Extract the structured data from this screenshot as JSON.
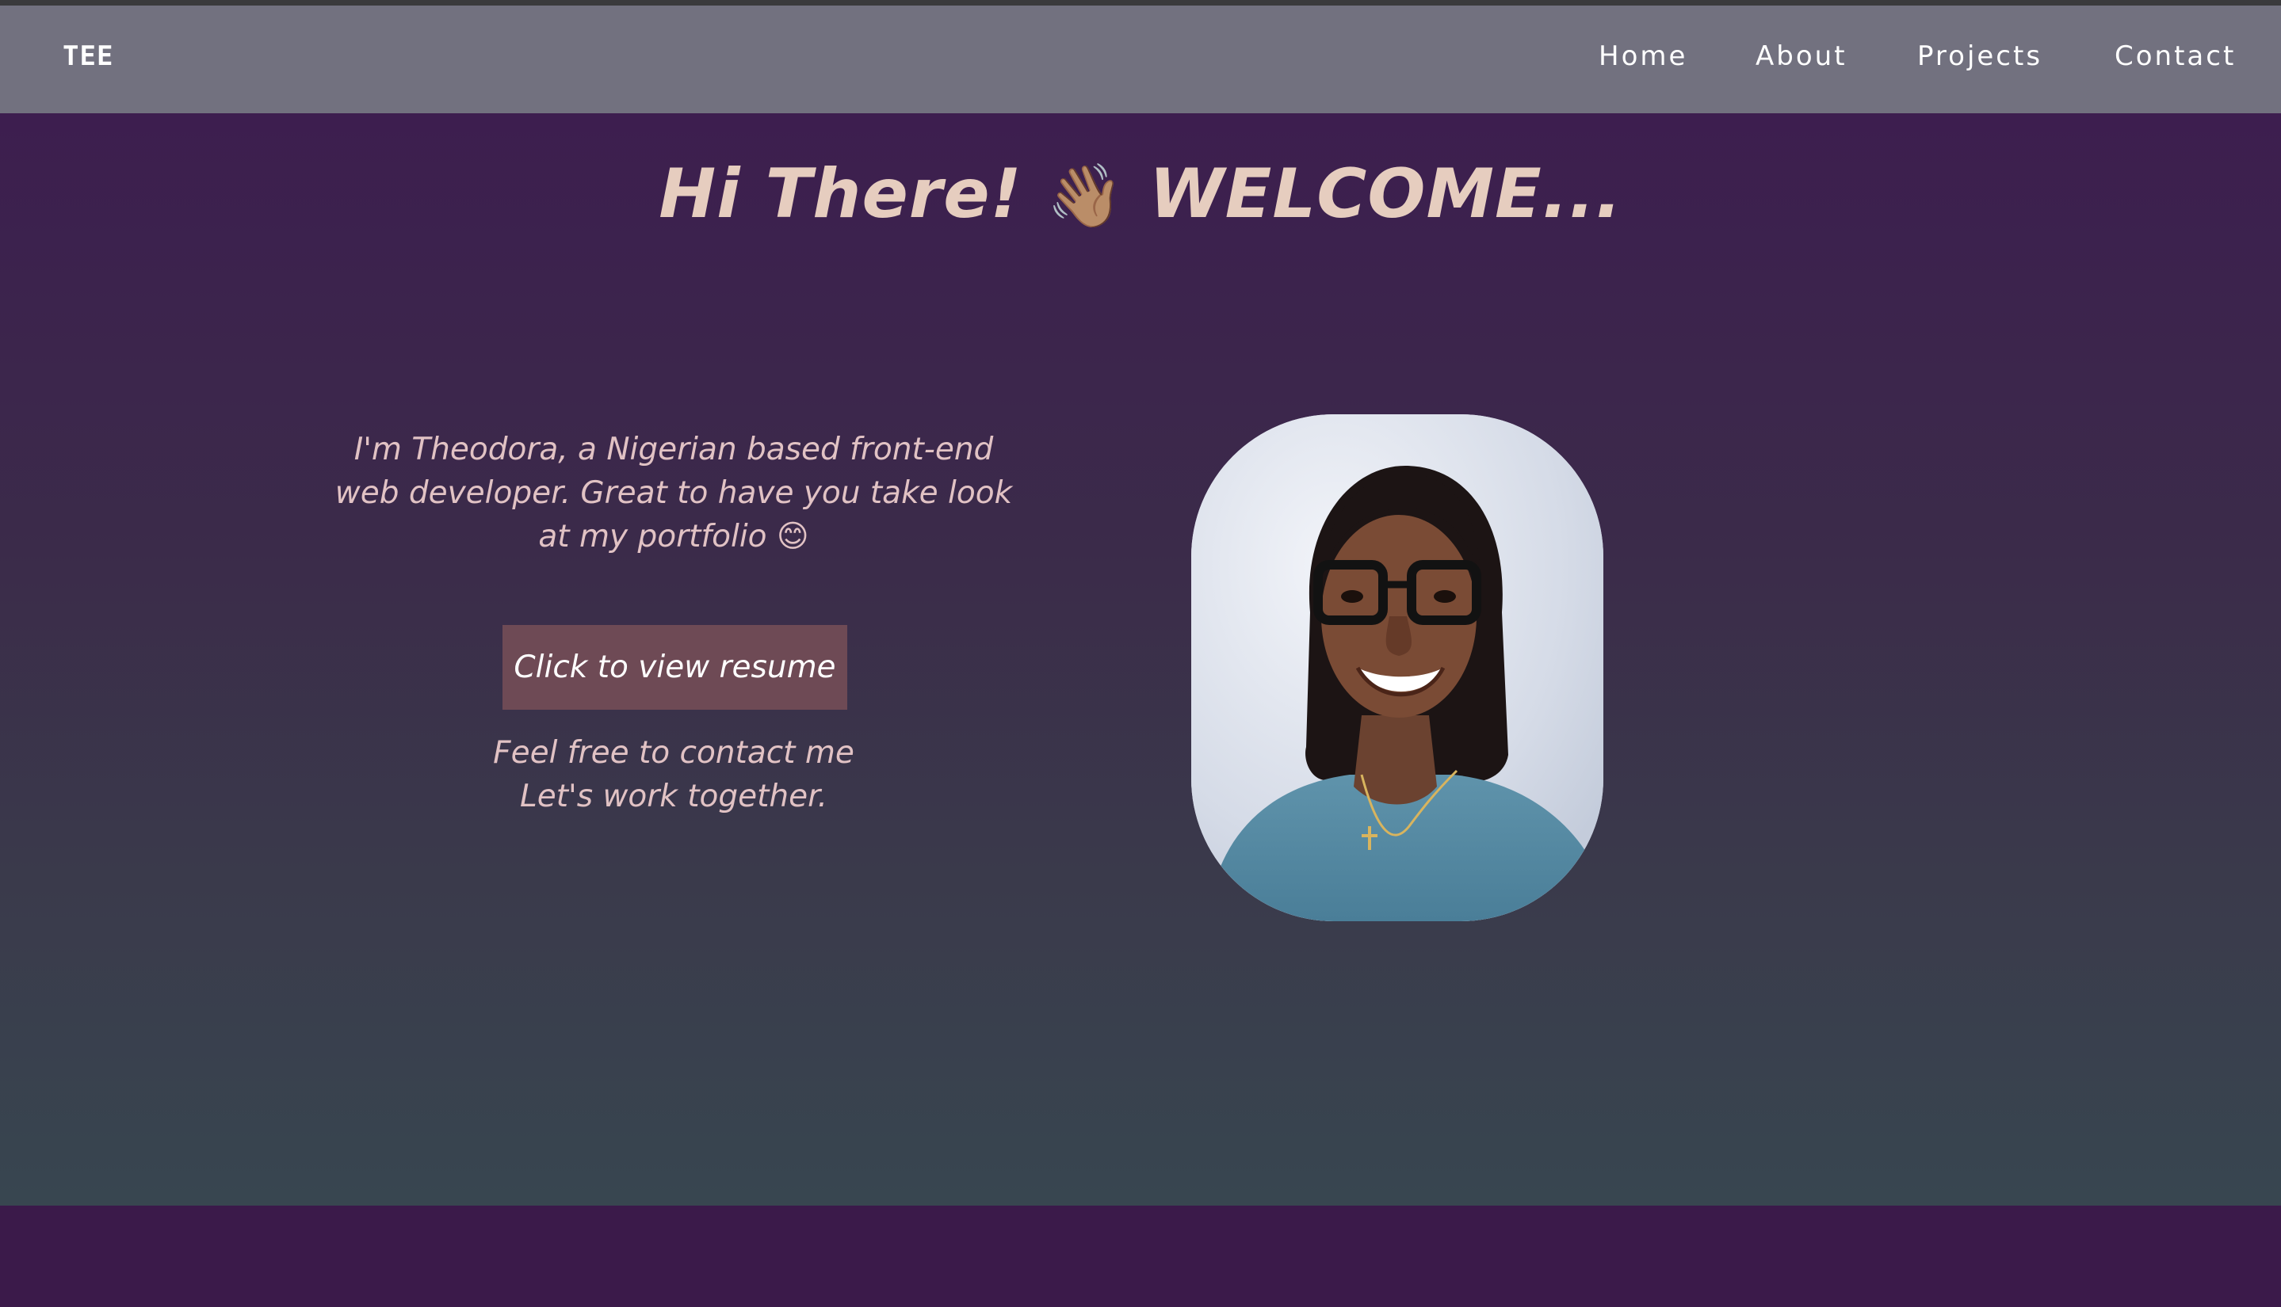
{
  "brand": {
    "logo": "TEE"
  },
  "nav": {
    "home": "Home",
    "about": "About",
    "projects": "Projects",
    "contact": "Contact"
  },
  "hero": {
    "welcome_before": "Hi There!",
    "welcome_emoji": "👋🏽",
    "welcome_after": "WELCOME...",
    "intro": "I'm Theodora, a Nigerian based front-end web developer. Great to have you take look at my portfolio 😊",
    "resume_button": "Click to view resume",
    "contact_line1": "Feel free to contact me",
    "contact_line2": "Let's work together."
  },
  "colors": {
    "navbar": "#72717f",
    "hero_top": "#3d1e4f",
    "hero_bottom": "#384650",
    "heading": "#e6cdbf",
    "body_text": "#e1c2c4",
    "button": "#6e4a55"
  },
  "profile_photo": {
    "icon": "portrait-photo"
  }
}
